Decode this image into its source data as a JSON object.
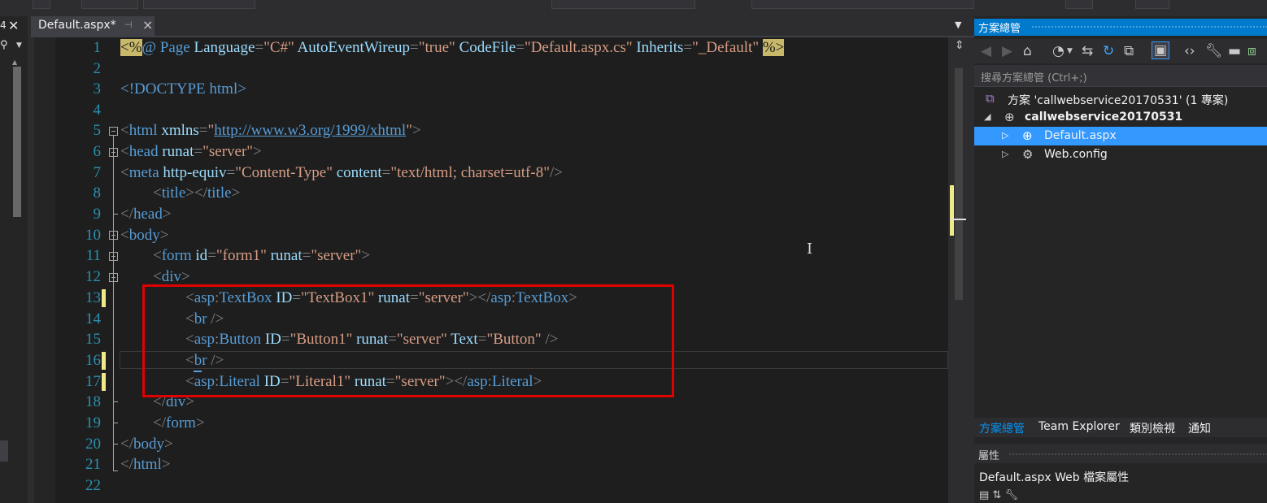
{
  "editor": {
    "tab_title": "Default.aspx*",
    "lines": [
      {
        "n": "1"
      },
      {
        "n": "2"
      },
      {
        "n": "3"
      },
      {
        "n": "4"
      },
      {
        "n": "5"
      },
      {
        "n": "6"
      },
      {
        "n": "7"
      },
      {
        "n": "8"
      },
      {
        "n": "9"
      },
      {
        "n": "10"
      },
      {
        "n": "11"
      },
      {
        "n": "12"
      },
      {
        "n": "13"
      },
      {
        "n": "14"
      },
      {
        "n": "15"
      },
      {
        "n": "16"
      },
      {
        "n": "17"
      },
      {
        "n": "18"
      },
      {
        "n": "19"
      },
      {
        "n": "20"
      },
      {
        "n": "21"
      },
      {
        "n": "22"
      }
    ],
    "code": {
      "l1": {
        "open": "<%",
        "dir": "@ Page",
        "a1": "Language",
        "v1": "\"C#\"",
        "a2": "AutoEventWireup",
        "v2": "\"true\"",
        "a3": "CodeFile",
        "v3": "\"Default.aspx.cs\"",
        "a4": "Inherits",
        "v4": "\"_Default\"",
        "close": "%>"
      },
      "l3": "<!DOCTYPE html>",
      "l5": {
        "tag": "html",
        "attr": "xmlns",
        "url": "http://www.w3.org/1999/xhtml"
      },
      "l6": {
        "tag": "head",
        "attr": "runat",
        "val": "\"server\""
      },
      "l7": {
        "tag": "meta",
        "a1": "http-equiv",
        "v1": "\"Content-Type\"",
        "a2": "content",
        "v2": "\"text/html; charset=utf-8\""
      },
      "l8": {
        "tag": "title",
        "end": "title"
      },
      "l9": {
        "tag": "head"
      },
      "l10": {
        "tag": "body"
      },
      "l11": {
        "tag": "form",
        "a1": "id",
        "v1": "\"form1\"",
        "a2": "runat",
        "v2": "\"server\""
      },
      "l12": {
        "tag": "div"
      },
      "l13": {
        "prefix": "asp",
        "tag": "TextBox",
        "a1": "ID",
        "v1": "\"TextBox1\"",
        "a2": "runat",
        "v2": "\"server\""
      },
      "l14": {
        "tag": "br"
      },
      "l15": {
        "prefix": "asp",
        "tag": "Button",
        "a1": "ID",
        "v1": "\"Button1\"",
        "a2": "runat",
        "v2": "\"server\"",
        "a3": "Text",
        "v3": "\"Button\""
      },
      "l16": {
        "tag": "br"
      },
      "l17": {
        "prefix": "asp",
        "tag": "Literal",
        "a1": "ID",
        "v1": "\"Literal1\"",
        "a2": "runat",
        "v2": "\"server\""
      },
      "l18": {
        "tag": "div"
      },
      "l19": {
        "tag": "form"
      },
      "l20": {
        "tag": "body"
      },
      "l21": {
        "tag": "html"
      }
    }
  },
  "solution_explorer": {
    "title": "方案總管",
    "search_placeholder": "搜尋方案總管 (Ctrl+;)",
    "tree": [
      {
        "label": "方案 'callwebservice20170531' (1 專案)",
        "icon": "solution-icon"
      },
      {
        "label": "callwebservice20170531",
        "icon": "website-icon"
      },
      {
        "label": "Default.aspx",
        "icon": "aspx-file-icon",
        "selected": true
      },
      {
        "label": "Web.config",
        "icon": "config-file-icon"
      }
    ],
    "bottom_tabs": [
      "方案總管",
      "Team Explorer",
      "類別檢視",
      "通知"
    ]
  },
  "properties": {
    "title": "屬性",
    "object_name": "Default.aspx",
    "object_desc": "Web 檔案屬性"
  },
  "colors": {
    "accent": "#007acc",
    "selection": "#3399ff",
    "highlight_box": "#e00000",
    "change_bar": "#efe98a"
  }
}
